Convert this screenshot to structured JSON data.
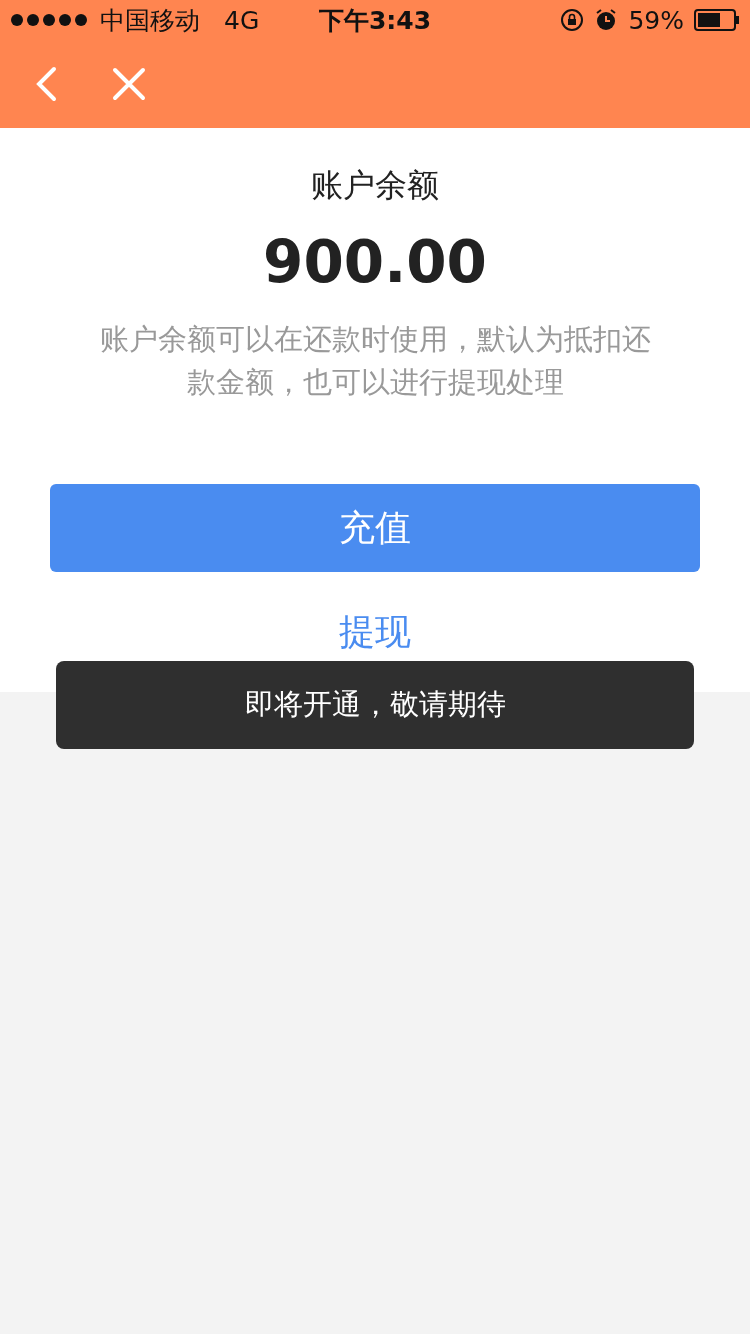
{
  "status_bar": {
    "carrier": "中国移动",
    "network": "4G",
    "time": "下午3:43",
    "battery": "59%"
  },
  "balance": {
    "title": "账户余额",
    "amount": "900.00",
    "description": "账户余额可以在还款时使用，默认为抵扣还款金额，也可以进行提现处理"
  },
  "buttons": {
    "recharge": "充值",
    "withdraw": "提现"
  },
  "toast": "即将开通，敬请期待"
}
